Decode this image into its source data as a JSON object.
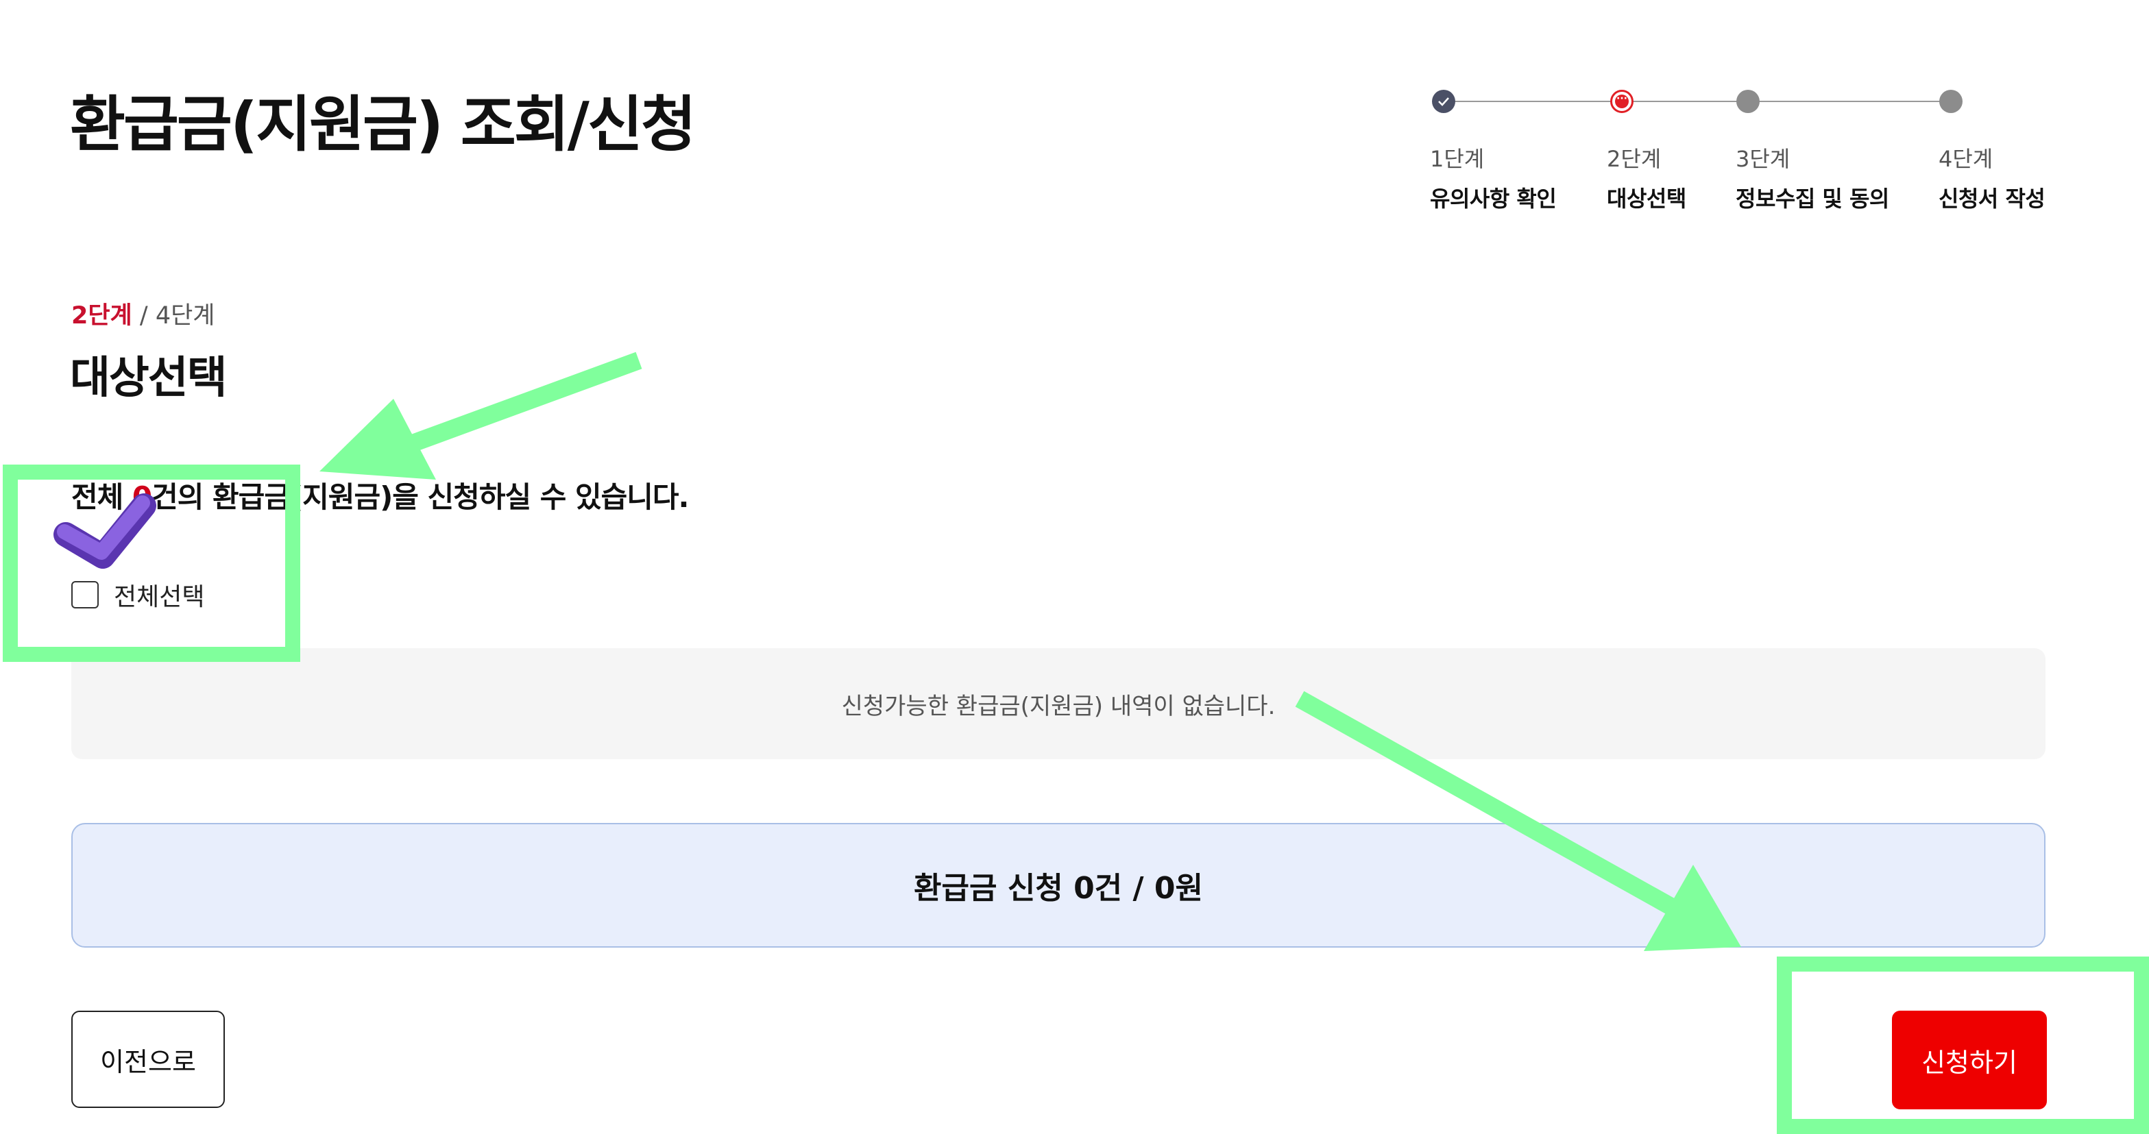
{
  "page": {
    "title": "환급금(지원금) 조회/신청"
  },
  "stepper": {
    "steps": [
      {
        "number": "1단계",
        "name": "유의사항 확인",
        "state": "done"
      },
      {
        "number": "2단계",
        "name": "대상선택",
        "state": "current"
      },
      {
        "number": "3단계",
        "name": "정보수집 및 동의",
        "state": "pending"
      },
      {
        "number": "4단계",
        "name": "신청서 작성",
        "state": "pending"
      }
    ]
  },
  "section": {
    "current_step": "2단계",
    "total_steps": "/ 4단계",
    "title": "대상선택",
    "summary_prefix": "전체 ",
    "summary_count": "0",
    "summary_suffix": "건의 환급금(지원금)을 신청하실 수 있습니다."
  },
  "select_all": {
    "label": "전체선택",
    "checked": false
  },
  "list": {
    "empty_message": "신청가능한 환급금(지원금) 내역이 없습니다."
  },
  "total": {
    "text": "환급금 신청 0건 / 0원"
  },
  "actions": {
    "prev_label": "이전으로",
    "apply_label": "신청하기"
  },
  "colors": {
    "accent_red": "#ee0000",
    "highlight_green": "#80ff9c",
    "total_box_bg": "#e8eefc",
    "checkmark_purple": "#7b4fd6"
  },
  "annotation_icons": [
    "purple-checkmark-icon",
    "green-arrow-icon",
    "green-arrow-icon"
  ]
}
